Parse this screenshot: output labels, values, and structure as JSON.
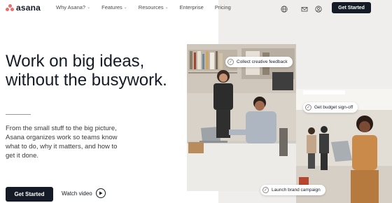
{
  "brand": {
    "name": "asana",
    "dot_color": "#f06a6a"
  },
  "nav": {
    "links": [
      {
        "label": "Why Asana?",
        "has_dropdown": true
      },
      {
        "label": "Features",
        "has_dropdown": true
      },
      {
        "label": "Resources",
        "has_dropdown": true
      },
      {
        "label": "Enterprise",
        "has_dropdown": false
      },
      {
        "label": "Pricing",
        "has_dropdown": false
      }
    ],
    "icons": [
      "globe-icon",
      "mail-icon",
      "user-icon"
    ],
    "cta_label": "Get Started"
  },
  "hero": {
    "headline_line1": "Work on big ideas,",
    "headline_line2": "without the busywork.",
    "subcopy": "From the small stuff to the big picture, Asana organizes work so teams know what to do, why it matters, and how to get it done.",
    "cta_label": "Get Started",
    "video_label": "Watch video"
  },
  "collage": {
    "tags": [
      "Collect creative feedback",
      "Get budget sign-off",
      "Launch brand campaign"
    ]
  },
  "colors": {
    "primary_dark": "#151b26",
    "panel_bg": "#efeeec"
  }
}
